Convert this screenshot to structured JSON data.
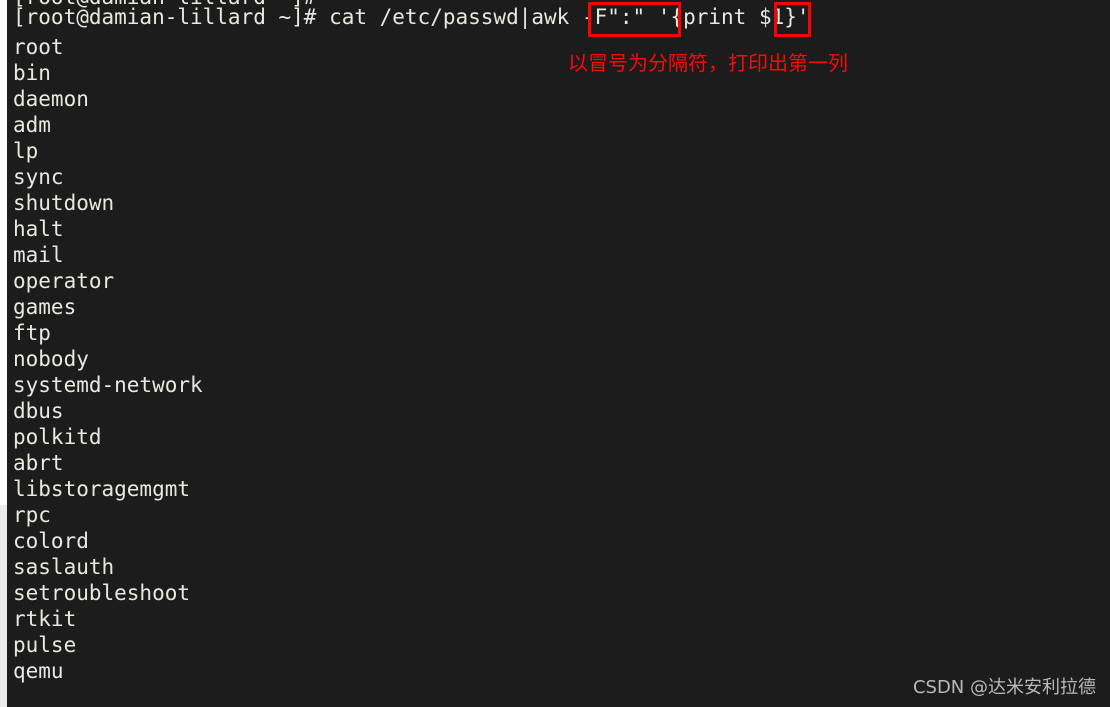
{
  "terminal": {
    "background_color": "#1c1c1c",
    "text_color": "#e8e8de",
    "clipped_prompt_line": "[root@damian-lillard ~]#",
    "command_line": "[root@damian-lillard ~]# cat /etc/passwd|awk -F\":\" '{print $1}'",
    "prompt": "[root@damian-lillard ~]#",
    "command": "cat /etc/passwd|awk -F\":\" '{print $1}'",
    "output": [
      "root",
      "bin",
      "daemon",
      "adm",
      "lp",
      "sync",
      "shutdown",
      "halt",
      "mail",
      "operator",
      "games",
      "ftp",
      "nobody",
      "systemd-network",
      "dbus",
      "polkitd",
      "abrt",
      "libstoragemgmt",
      "rpc",
      "colord",
      "saslauth",
      "setroubleshoot",
      "rtkit",
      "pulse",
      "qemu"
    ]
  },
  "annotations": {
    "color": "#ff0000",
    "note_text": "以冒号为分隔符，打印出第一列",
    "box_delimiter_label": "-F\":\"",
    "box_field_label": "$1"
  },
  "scrollbar": {
    "track_color": "#ebebeb",
    "thumb_color": "#fbfbfb"
  },
  "watermark": {
    "text": "CSDN @达米安利拉德",
    "color": "#b9b9b9"
  }
}
